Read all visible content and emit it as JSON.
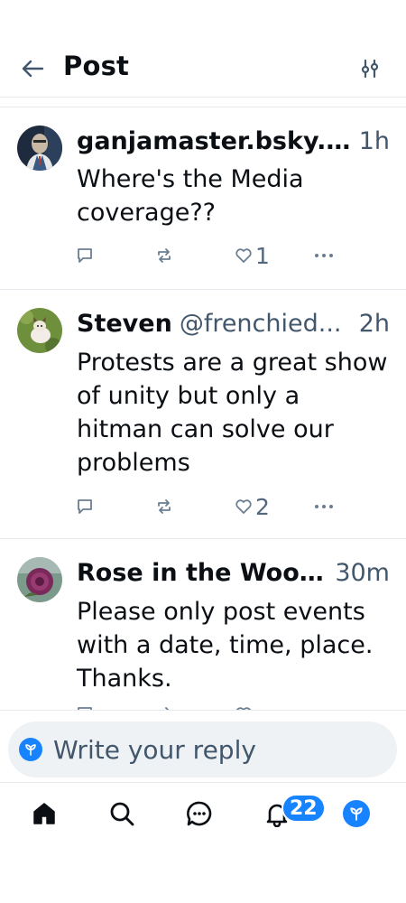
{
  "header": {
    "title": "Post",
    "back_icon": "arrow-left-icon",
    "filter_icon": "sliders-icon"
  },
  "posts": [
    {
      "author": "ganjamaster.bsky.s..",
      "handle": "",
      "time": "1h",
      "text": "Where's the Media coverage??",
      "reply_count": "",
      "repost_count": "",
      "like_count": "1"
    },
    {
      "author": "Steven",
      "handle": "@frenchied...",
      "time": "2h",
      "text": "Protests are a great show of unity but only a hitman can solve our problems",
      "reply_count": "",
      "repost_count": "",
      "like_count": "2"
    },
    {
      "author": "Rose in the Wood..",
      "handle": "",
      "time": "30m",
      "text": "Please only post events with a date, time, place. Thanks.",
      "reply_count": "",
      "repost_count": "",
      "like_count": ""
    }
  ],
  "reply": {
    "placeholder": "Write your reply"
  },
  "nav": {
    "items": [
      "home-icon",
      "search-icon",
      "chat-icon",
      "bell-icon",
      "profile-avatar"
    ],
    "notification_badge": "22"
  },
  "colors": {
    "accent": "#1883ff",
    "muted_text": "#42576c",
    "divider": "#e6eaee",
    "input_bg": "#eff2f5"
  }
}
